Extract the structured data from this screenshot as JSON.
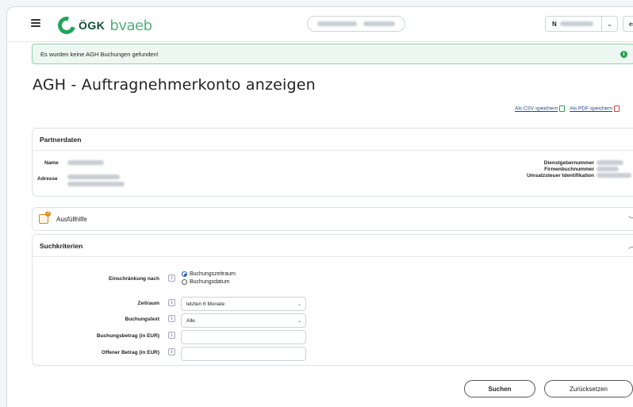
{
  "header": {
    "logo_text": "ÖGK",
    "logo_sub": "bvaeb",
    "lang_value": "N",
    "chevron_down": "⌄",
    "logout_glyph": "⇐"
  },
  "alert": {
    "message": "Es wurden keine AGH Buchungen gefunden!",
    "icon": "i"
  },
  "page": {
    "title": "AGH - Auftragnehmerkonto anzeigen"
  },
  "export": {
    "csv_label": "Als CSV speichern",
    "pdf_label": "Als PDF speichern"
  },
  "partner": {
    "heading": "Partnerdaten",
    "name_label": "Name",
    "address_label": "Adresse",
    "dg_label": "Dienstgebernummer",
    "fb_label": "Firmenbuchnummer",
    "ust_label": "Umsatzsteuer Identifikation"
  },
  "help": {
    "heading": "Ausfüllhilfe",
    "chevron": "﹀"
  },
  "search": {
    "heading": "Suchkriterien",
    "chevron": "︿",
    "restriction_label": "Einschränkung nach",
    "radio_period": "Buchungszeitraum",
    "radio_date": "Buchungsdatum",
    "period_label": "Zeitraum",
    "period_value": "letzten 6 Monate",
    "text_label": "Buchungstext",
    "text_value": "Alle",
    "amount_label": "Buchungsbetrag (in EUR)",
    "open_amount_label": "Offener Betrag (in EUR)",
    "info_glyph": "i",
    "dd_glyph": "⌄"
  },
  "actions": {
    "search_label": "Suchen",
    "reset_label": "Zurücksetzen"
  },
  "colors": {
    "brand_green": "#1fa65a",
    "alert_bg": "#eef8f3",
    "link": "#1a4b8c"
  }
}
